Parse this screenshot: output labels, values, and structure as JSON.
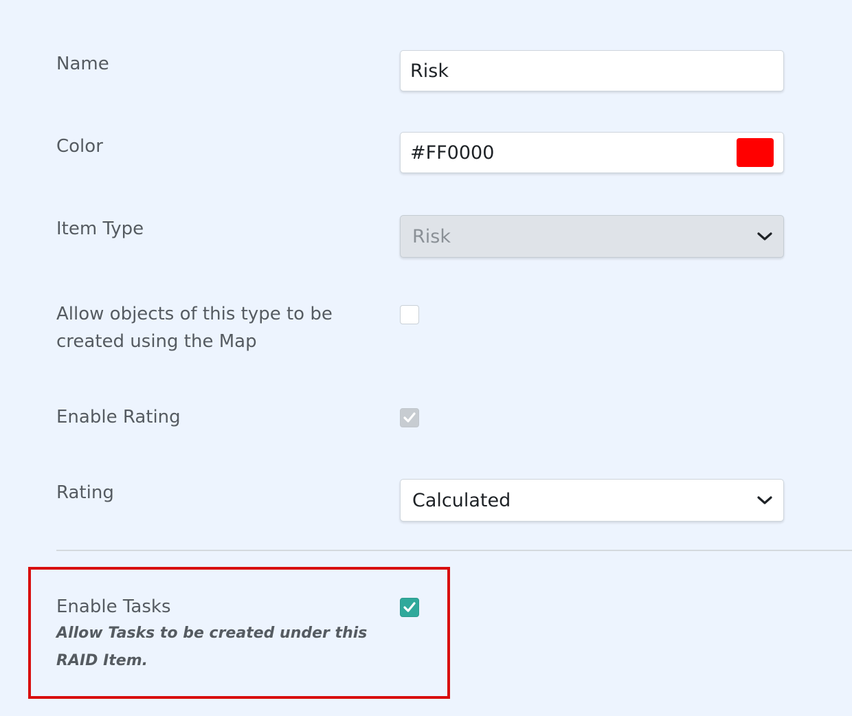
{
  "form": {
    "name": {
      "label": "Name",
      "value": "Risk"
    },
    "color": {
      "label": "Color",
      "value": "#FF0000",
      "swatch": "#ff0000"
    },
    "item_type": {
      "label": "Item Type",
      "value": "Risk",
      "disabled": true,
      "icon": "chevron-down-icon"
    },
    "allow_map": {
      "label": "Allow objects of this type to be created using the Map",
      "checked": false
    },
    "enable_rating": {
      "label": "Enable Rating",
      "checked": true,
      "disabled": true
    },
    "rating": {
      "label": "Rating",
      "value": "Calculated",
      "icon": "chevron-down-icon"
    },
    "enable_tasks": {
      "label": "Enable Tasks",
      "help": "Allow Tasks to be created under this RAID Item.",
      "checked": true,
      "highlighted": true
    }
  },
  "colors": {
    "background": "#edf4fe",
    "checkbox_checked": "#2fa99b",
    "highlight_border": "#d80d0d"
  }
}
